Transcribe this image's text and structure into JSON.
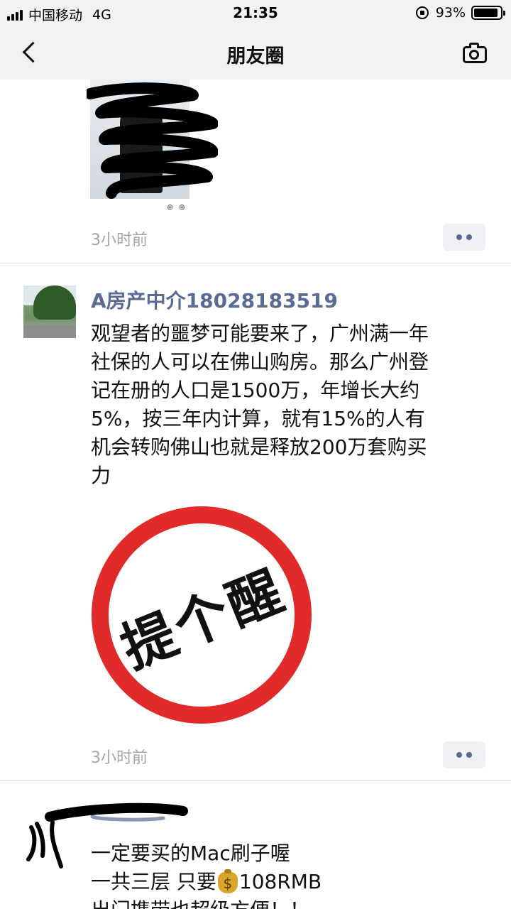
{
  "status_bar": {
    "carrier": "中国移动",
    "network": "4G",
    "time": "21:35",
    "battery": "93%",
    "battery_level": 0.93
  },
  "nav": {
    "title": "朋友圈",
    "back_icon": "chevron-left-icon",
    "camera_icon": "camera-icon"
  },
  "posts": [
    {
      "time": "3小时前",
      "photo_icons": "⊕ ⊕"
    },
    {
      "username": "A房产中介18028183519",
      "text": "观望者的噩梦可能要来了，广州满一年\n社保的人可以在佛山购房。那么广州登\n记在册的人口是1500万，年增长大约\n5%，按三年内计算，就有15%的人有\n机会转购佛山也就是释放200万套购买\n力",
      "image_text": "提个醒",
      "time": "3小时前"
    },
    {
      "lines": [
        "一定要买的Mac刷子喔",
        "一共三层 只要",
        "108RMB",
        "出门携带也超级方便！！"
      ],
      "money_icon": "money-bag-icon"
    }
  ],
  "colors": {
    "link_blue": "#5b6a92",
    "sign_red": "#e12a2a",
    "time_gray": "#a5a5a5"
  }
}
